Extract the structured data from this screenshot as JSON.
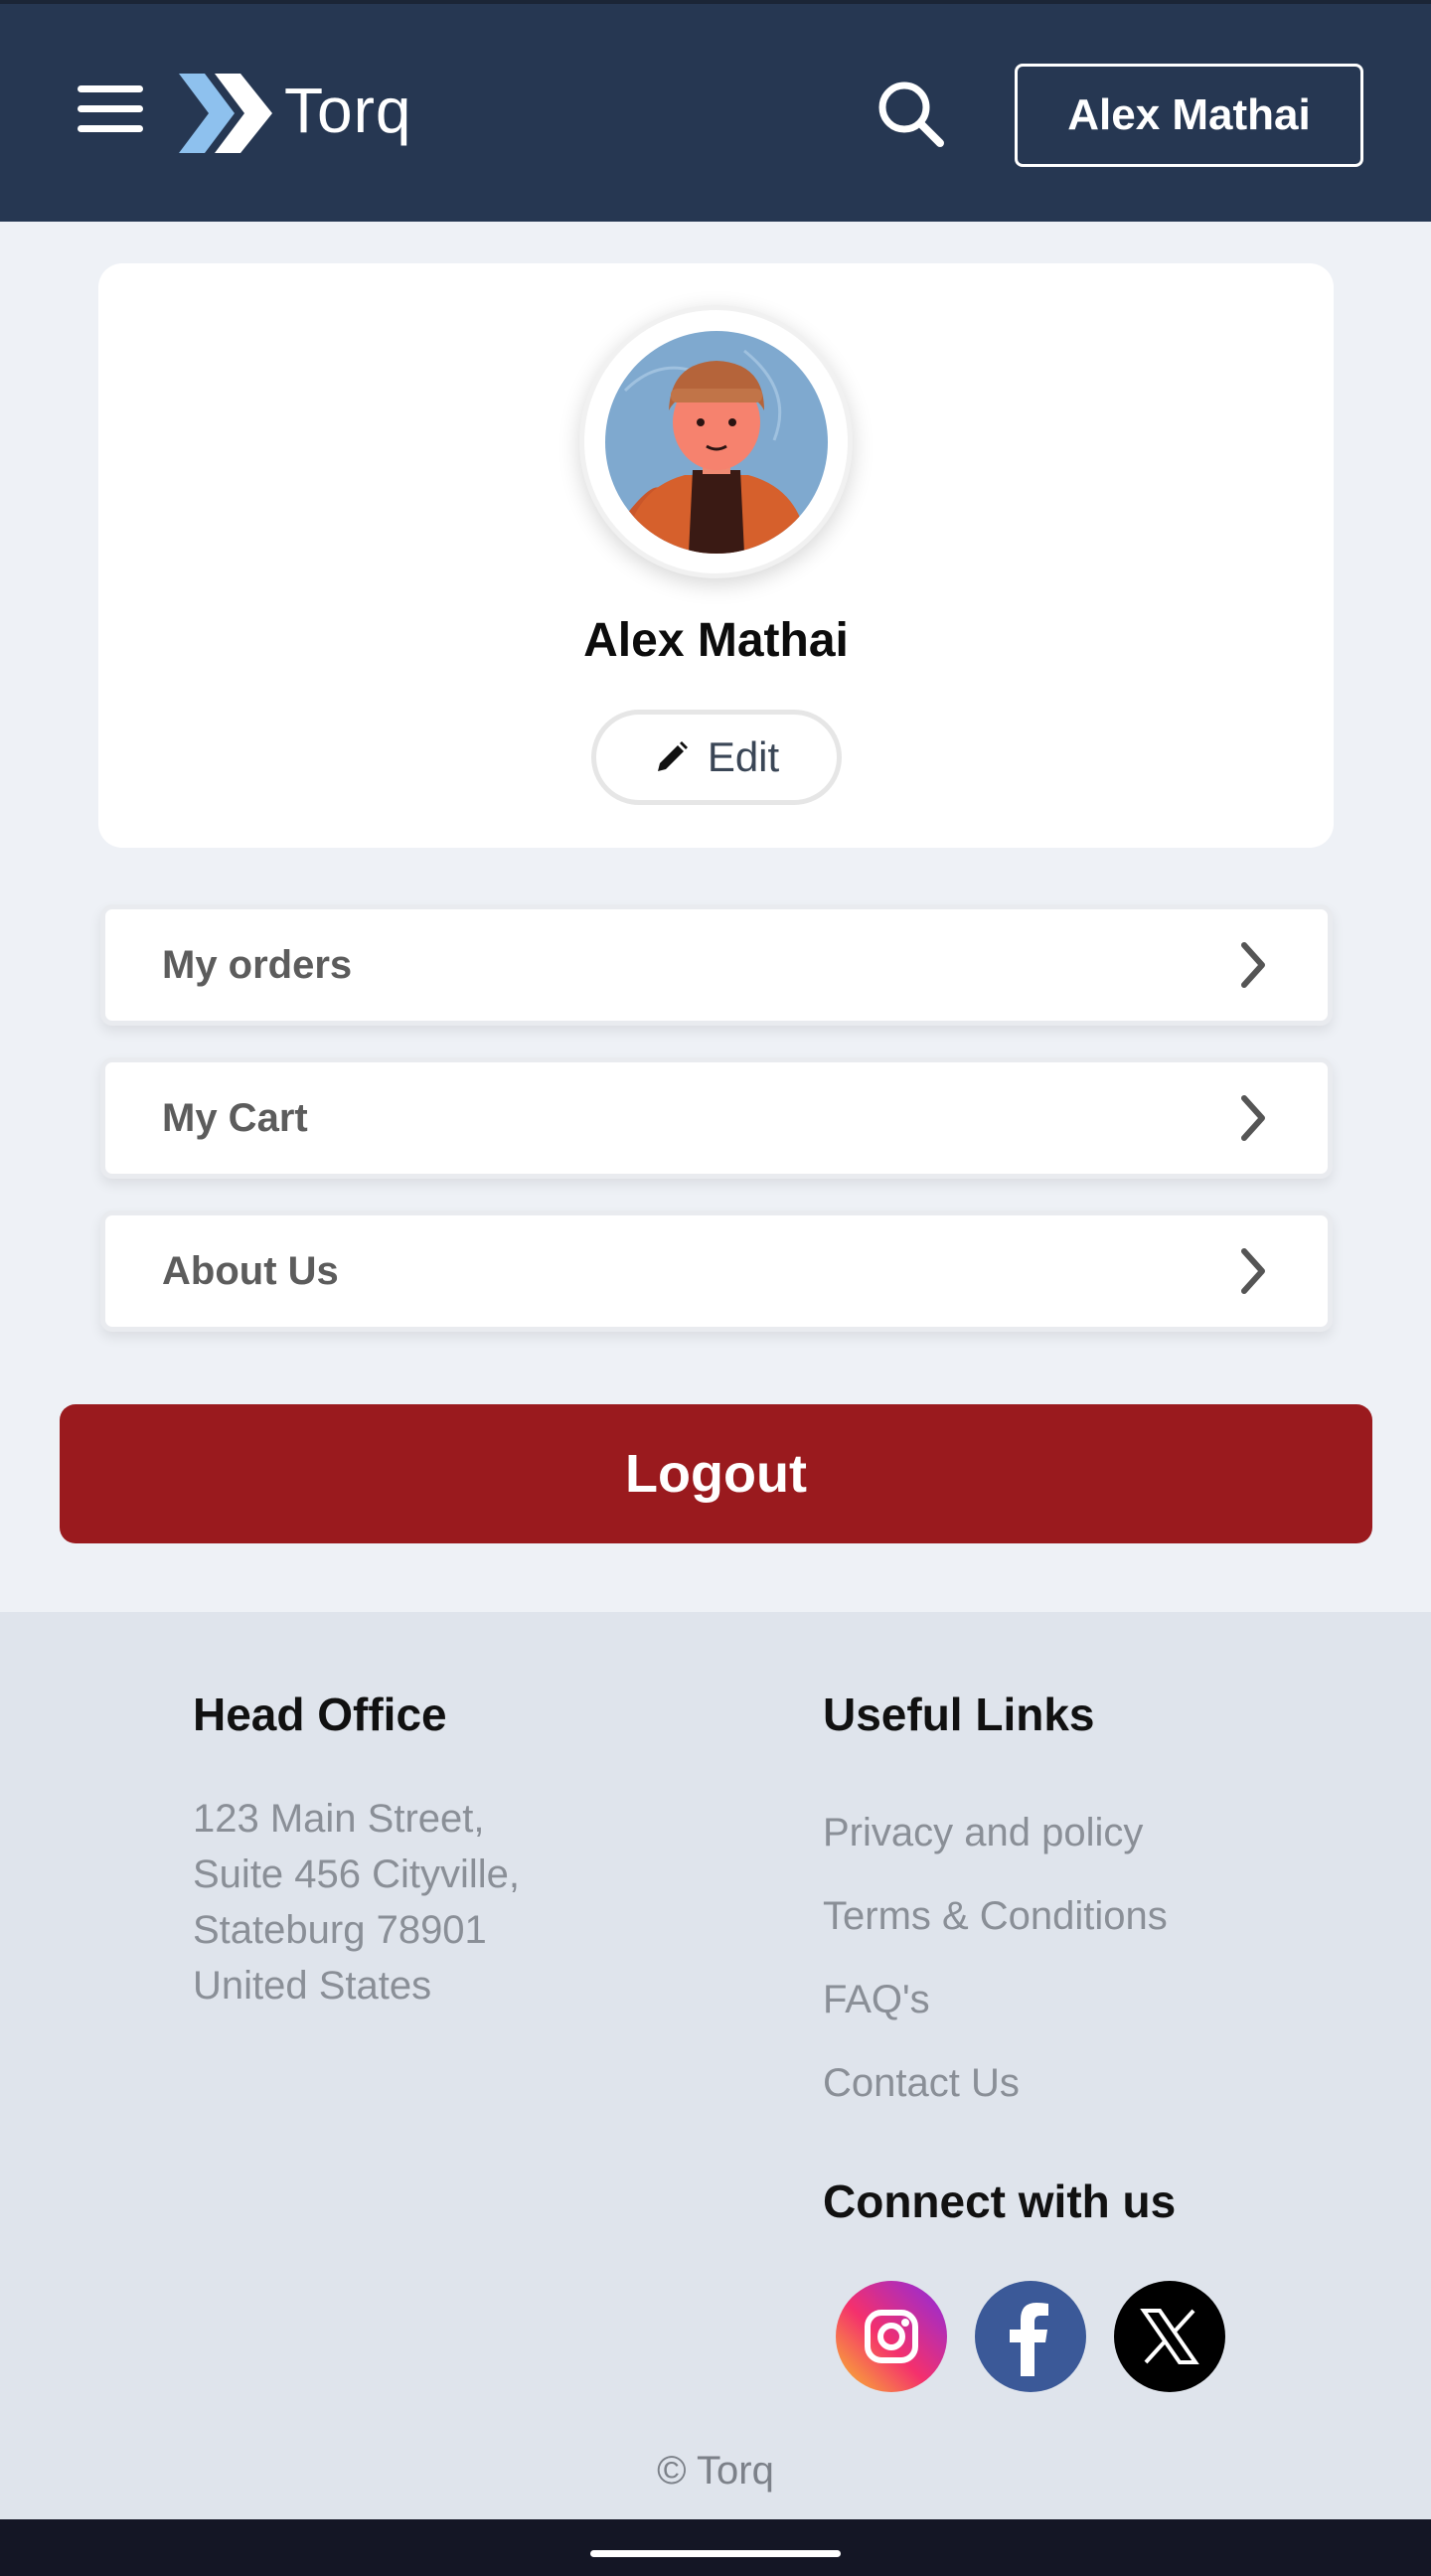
{
  "header": {
    "brand": "Torq",
    "user_button": "Alex Mathai"
  },
  "profile": {
    "name": "Alex Mathai",
    "edit_label": "Edit"
  },
  "menu": {
    "items": [
      {
        "label": "My orders"
      },
      {
        "label": "My Cart"
      },
      {
        "label": "About Us"
      }
    ]
  },
  "logout_label": "Logout",
  "footer": {
    "head_office_title": "Head Office",
    "address": [
      "123 Main Street,",
      "Suite 456 Cityville,",
      "Stateburg 78901",
      "United States"
    ],
    "useful_links_title": "Useful Links",
    "links": [
      "Privacy and policy",
      "Terms & Conditions",
      "FAQ's",
      "Contact Us"
    ],
    "connect_title": "Connect with us",
    "social": [
      "instagram-icon",
      "facebook-icon",
      "x-icon"
    ],
    "copyright": "© Torq"
  },
  "colors": {
    "header_bg": "#263752",
    "logout_bg": "#9a1a1e",
    "footer_bg": "#dfe4ec",
    "page_bg": "#eef1f6"
  }
}
